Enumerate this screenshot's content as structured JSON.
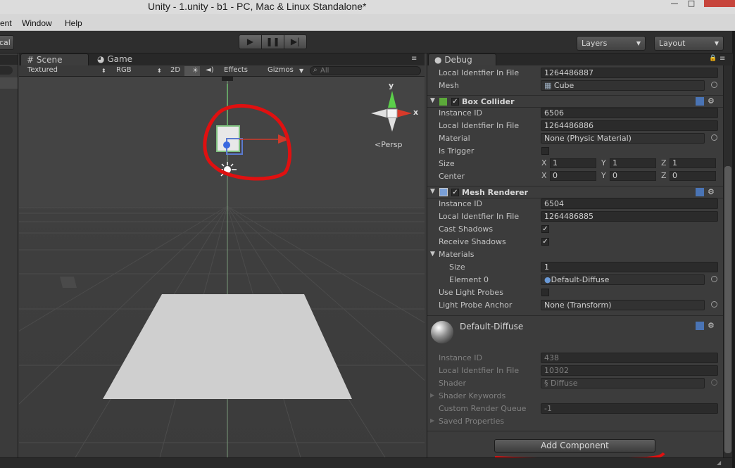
{
  "window": {
    "title": "Unity - 1.unity - b1 - PC, Mac & Linux Standalone*",
    "minimize": "—",
    "maximize": "□"
  },
  "menu": {
    "items": [
      "ent",
      "Window",
      "Help"
    ]
  },
  "toolbar": {
    "left_dropdown": "cal",
    "play": "▶",
    "pause": "❚❚",
    "step": "▶|",
    "layers": "Layers",
    "layout": "Layout"
  },
  "scene": {
    "tabs": {
      "scene": "Scene",
      "game": "Game"
    },
    "toolbar": {
      "shading": "Textured",
      "render_mode": "RGB",
      "mode_2d": "2D",
      "sun": "☀",
      "audio": "◄)",
      "effects": "Effects",
      "gizmos": "Gizmos",
      "search_placeholder": "All"
    },
    "gizmo": {
      "y": "y",
      "x": "x",
      "persp": "Persp"
    }
  },
  "inspector": {
    "tab": "Debug",
    "top_rows": [
      {
        "label": "Local Identfier In File",
        "value": "1264486887"
      },
      {
        "label": "Mesh",
        "value": "Cube"
      }
    ],
    "box_collider": {
      "name": "Box Collider",
      "instance_id_label": "Instance ID",
      "instance_id": "6506",
      "local_id_label": "Local Identfier In File",
      "local_id": "1264486886",
      "material_label": "Material",
      "material": "None (Physic Material)",
      "trigger_label": "Is Trigger",
      "size_label": "Size",
      "size": {
        "x": "1",
        "y": "1",
        "z": "1"
      },
      "center_label": "Center",
      "center": {
        "x": "0",
        "y": "0",
        "z": "0"
      }
    },
    "mesh_renderer": {
      "name": "Mesh Renderer",
      "instance_id_label": "Instance ID",
      "instance_id": "6504",
      "local_id_label": "Local Identfier In File",
      "local_id": "1264486885",
      "cast_shadows_label": "Cast Shadows",
      "receive_shadows_label": "Receive Shadows",
      "materials_label": "Materials",
      "size_label": "Size",
      "size": "1",
      "element0_label": "Element 0",
      "element0": "Default-Diffuse",
      "light_probes_label": "Use Light Probes",
      "probe_anchor_label": "Light Probe Anchor",
      "probe_anchor": "None (Transform)"
    },
    "material": {
      "name": "Default-Diffuse",
      "instance_id_label": "Instance ID",
      "instance_id": "438",
      "local_id_label": "Local Identfier In File",
      "local_id": "10302",
      "shader_label": "Shader",
      "shader": "Diffuse",
      "keywords_label": "Shader Keywords",
      "queue_label": "Custom Render Queue",
      "queue": "-1",
      "saved_label": "Saved Properties"
    },
    "add_component": "Add Component"
  }
}
